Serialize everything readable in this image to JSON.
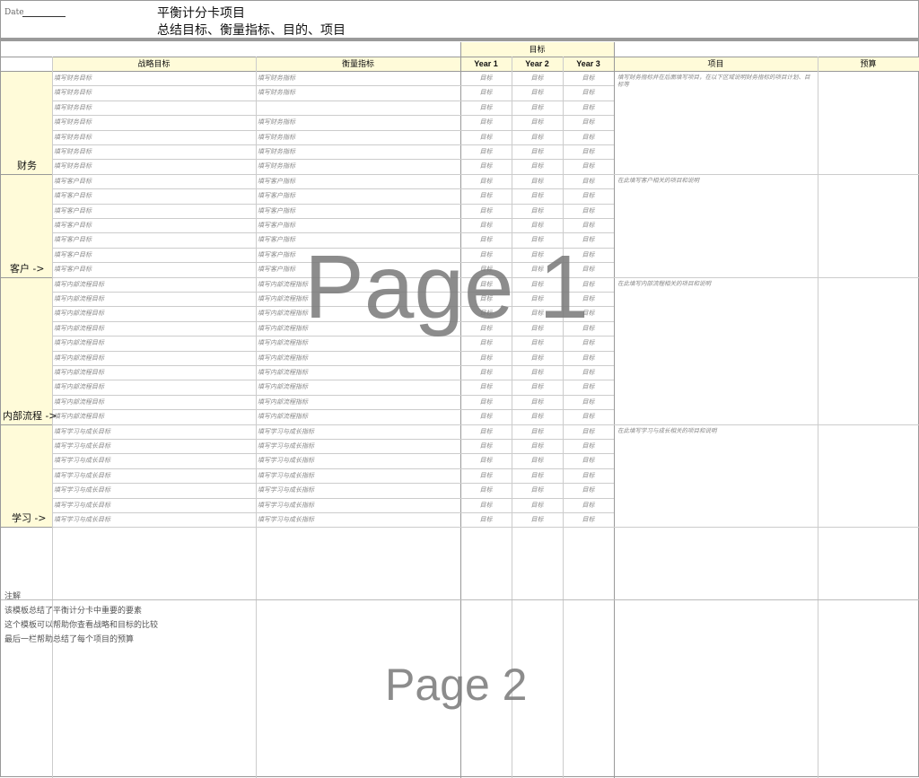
{
  "header": {
    "date_label": "Date",
    "title": "平衡计分卡项目",
    "subtitle": "总结目标、衡量指标、目的、项目"
  },
  "columns": {
    "goals_group": "目标",
    "strategic": "战略目标",
    "measure": "衡量指标",
    "year1": "Year 1",
    "year2": "Year 2",
    "year3": "Year 3",
    "projects": "项目",
    "budget": "预算"
  },
  "target_value": "目标",
  "perspectives": [
    {
      "label": "财务",
      "project_note": "填写财务指标并在后面填写项目，在以下区域说明财务指标的项目计划、目标等",
      "rows": [
        {
          "objective": "填写财务目标",
          "measure": "填写财务指标"
        },
        {
          "objective": "填写财务目标",
          "measure": "填写财务指标"
        },
        {
          "objective": "填写财务目标",
          "measure": ""
        },
        {
          "objective": "填写财务目标",
          "measure": "填写财务指标"
        },
        {
          "objective": "填写财务目标",
          "measure": "填写财务指标"
        },
        {
          "objective": "填写财务目标",
          "measure": "填写财务指标"
        },
        {
          "objective": "填写财务目标",
          "measure": "填写财务指标"
        }
      ]
    },
    {
      "label": "客户 ->",
      "project_note": "在此填写客户相关的项目和说明",
      "rows": [
        {
          "objective": "填写客户目标",
          "measure": "填写客户指标"
        },
        {
          "objective": "填写客户目标",
          "measure": "填写客户指标"
        },
        {
          "objective": "填写客户目标",
          "measure": "填写客户指标"
        },
        {
          "objective": "填写客户目标",
          "measure": "填写客户指标"
        },
        {
          "objective": "填写客户目标",
          "measure": "填写客户指标"
        },
        {
          "objective": "填写客户目标",
          "measure": "填写客户指标"
        },
        {
          "objective": "填写客户目标",
          "measure": "填写客户指标"
        }
      ]
    },
    {
      "label": "内部流程 ->",
      "project_note": "在此填写内部流程相关的项目和说明",
      "rows": [
        {
          "objective": "填写内部流程目标",
          "measure": "填写内部流程指标"
        },
        {
          "objective": "填写内部流程目标",
          "measure": "填写内部流程指标"
        },
        {
          "objective": "填写内部流程目标",
          "measure": "填写内部流程指标"
        },
        {
          "objective": "填写内部流程目标",
          "measure": "填写内部流程指标"
        },
        {
          "objective": "填写内部流程目标",
          "measure": "填写内部流程指标"
        },
        {
          "objective": "填写内部流程目标",
          "measure": "填写内部流程指标"
        },
        {
          "objective": "填写内部流程目标",
          "measure": "填写内部流程指标"
        },
        {
          "objective": "填写内部流程目标",
          "measure": "填写内部流程指标"
        },
        {
          "objective": "填写内部流程目标",
          "measure": "填写内部流程指标"
        },
        {
          "objective": "填写内部流程目标",
          "measure": "填写内部流程指标"
        }
      ]
    },
    {
      "label": "学习 ->",
      "project_note": "在此填写学习与成长相关的项目和说明",
      "rows": [
        {
          "objective": "填写学习与成长目标",
          "measure": "填写学习与成长指标"
        },
        {
          "objective": "填写学习与成长目标",
          "measure": "填写学习与成长指标"
        },
        {
          "objective": "填写学习与成长目标",
          "measure": "填写学习与成长指标"
        },
        {
          "objective": "填写学习与成长目标",
          "measure": "填写学习与成长指标"
        },
        {
          "objective": "填写学习与成长目标",
          "measure": "填写学习与成长指标"
        },
        {
          "objective": "填写学习与成长目标",
          "measure": "填写学习与成长指标"
        },
        {
          "objective": "填写学习与成长目标",
          "measure": "填写学习与成长指标"
        }
      ]
    }
  ],
  "notes": {
    "title": "注解",
    "lines": [
      "该模板总结了平衡计分卡中重要的要素",
      "这个模板可以帮助你查看战略和目标的比较",
      "最后一栏帮助总结了每个项目的预算"
    ]
  },
  "watermarks": {
    "page1": "Page 1",
    "page2": "Page 2"
  }
}
